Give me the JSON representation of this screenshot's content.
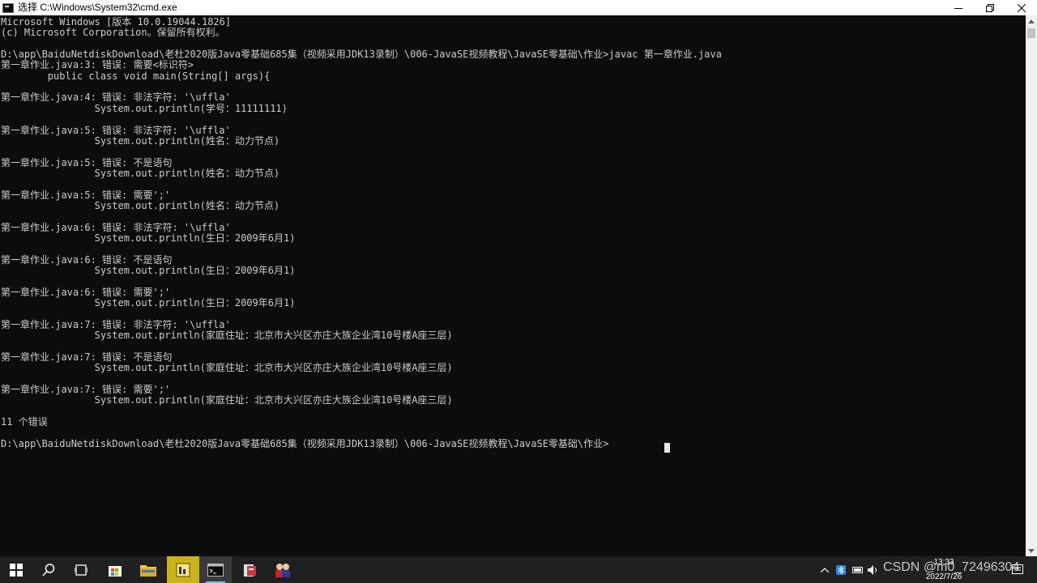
{
  "window": {
    "title": "选择 C:\\Windows\\System32\\cmd.exe",
    "minimize_icon": "minimize-icon",
    "restore_icon": "restore-icon",
    "close_icon": "close-icon"
  },
  "console": {
    "lines": [
      "Microsoft Windows [版本 10.0.19044.1826]",
      "(c) Microsoft Corporation。保留所有权利。",
      "",
      "D:\\app\\BaiduNetdiskDownload\\老杜2020版Java零基础685集（视频采用JDK13录制）\\006-JavaSE视频教程\\JavaSE零基础\\作业>javac 第一章作业.java",
      "第一章作业.java:3: 错误: 需要<标识符>",
      "        public class void main(String[] args){",
      "",
      "第一章作业.java:4: 错误: 非法字符: '\\uffla'",
      "                System.out.println(学号：11111111)",
      "",
      "第一章作业.java:5: 错误: 非法字符: '\\uffla'",
      "                System.out.println(姓名：动力节点)",
      "",
      "第一章作业.java:5: 错误: 不是语句",
      "                System.out.println(姓名：动力节点)",
      "",
      "第一章作业.java:5: 错误: 需要';'",
      "                System.out.println(姓名：动力节点)",
      "",
      "第一章作业.java:6: 错误: 非法字符: '\\uffla'",
      "                System.out.println(生日：2009年6月1)",
      "",
      "第一章作业.java:6: 错误: 不是语句",
      "                System.out.println(生日：2009年6月1)",
      "",
      "第一章作业.java:6: 错误: 需要';'",
      "                System.out.println(生日：2009年6月1)",
      "",
      "第一章作业.java:7: 错误: 非法字符: '\\uffla'",
      "                System.out.println(家庭住址：北京市大兴区亦庄大族企业湾10号楼A座三层)",
      "",
      "第一章作业.java:7: 错误: 不是语句",
      "                System.out.println(家庭住址：北京市大兴区亦庄大族企业湾10号楼A座三层)",
      "",
      "第一章作业.java:7: 错误: 需要';'",
      "                System.out.println(家庭住址：北京市大兴区亦庄大族企业湾10号楼A座三层)",
      "",
      "11 个错误",
      "",
      "D:\\app\\BaiduNetdiskDownload\\老杜2020版Java零基础685集（视频采用JDK13录制）\\006-JavaSE视频教程\\JavaSE零基础\\作业>"
    ]
  },
  "taskbar": {
    "items": [
      {
        "name": "start-button",
        "icon": "windows-logo-icon"
      },
      {
        "name": "search-button",
        "icon": "search-icon"
      },
      {
        "name": "task-view-button",
        "icon": "task-view-icon"
      },
      {
        "name": "store-app",
        "icon": "store-icon"
      },
      {
        "name": "file-explorer-app",
        "icon": "folder-icon"
      },
      {
        "name": "highlighted-app",
        "icon": "app-icon"
      },
      {
        "name": "cmd-app",
        "icon": "terminal-icon"
      },
      {
        "name": "red-app",
        "icon": "app-icon"
      },
      {
        "name": "people-app",
        "icon": "app-icon"
      }
    ],
    "clock": {
      "time": "13:33",
      "date": "2022/7/26"
    }
  },
  "watermark": "CSDN @m0_72496304"
}
